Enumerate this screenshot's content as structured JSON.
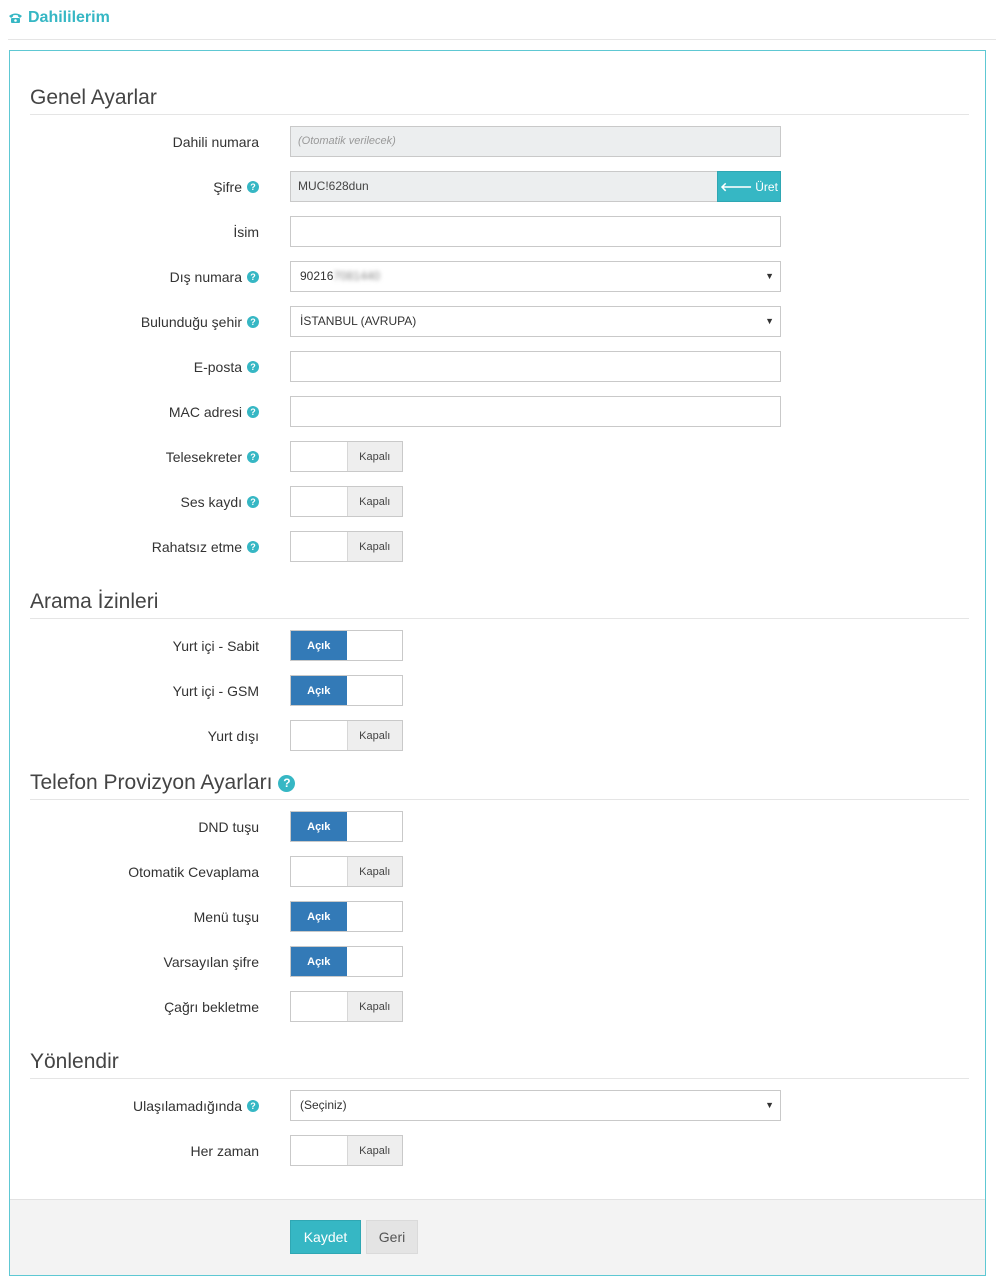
{
  "header": {
    "title": "Dahililerim",
    "icon": "phone-icon"
  },
  "sections": {
    "general": "Genel Ayarlar",
    "call_permissions": "Arama İzinleri",
    "provisioning": "Telefon Provizyon Ayarları",
    "forwarding": "Yönlendir"
  },
  "fields": {
    "extension": {
      "label": "Dahili numara",
      "placeholder": "(Otomatik verilecek)"
    },
    "password": {
      "label": "Şifre",
      "value": "MUC!628dun",
      "generate": "Üret"
    },
    "name": {
      "label": "İsim",
      "value": ""
    },
    "outer_number": {
      "label": "Dış numara",
      "value_prefix": "90216",
      "value_masked": "7081440"
    },
    "city": {
      "label": "Bulunduğu şehir",
      "value": "İSTANBUL (AVRUPA)"
    },
    "email": {
      "label": "E-posta",
      "value": ""
    },
    "mac": {
      "label": "MAC adresi",
      "value": ""
    },
    "voicemail": {
      "label": "Telesekreter",
      "state": "Kapalı"
    },
    "recording": {
      "label": "Ses kaydı",
      "state": "Kapalı"
    },
    "dnd": {
      "label": "Rahatsız etme",
      "state": "Kapalı"
    },
    "domestic_fixed": {
      "label": "Yurt içi - Sabit",
      "state": "Açık"
    },
    "domestic_gsm": {
      "label": "Yurt içi - GSM",
      "state": "Açık"
    },
    "international": {
      "label": "Yurt dışı",
      "state": "Kapalı"
    },
    "dnd_key": {
      "label": "DND tuşu",
      "state": "Açık"
    },
    "auto_answer": {
      "label": "Otomatik Cevaplama",
      "state": "Kapalı"
    },
    "menu_key": {
      "label": "Menü tuşu",
      "state": "Açık"
    },
    "default_password": {
      "label": "Varsayılan şifre",
      "state": "Açık"
    },
    "call_waiting": {
      "label": "Çağrı bekletme",
      "state": "Kapalı"
    },
    "unreachable": {
      "label": "Ulaşılamadığında",
      "value": "(Seçiniz)"
    },
    "always": {
      "label": "Her zaman",
      "state": "Kapalı"
    }
  },
  "buttons": {
    "save": "Kaydet",
    "back": "Geri"
  },
  "colors": {
    "accent": "#36b7c4",
    "toggle_on": "#337ab7"
  }
}
